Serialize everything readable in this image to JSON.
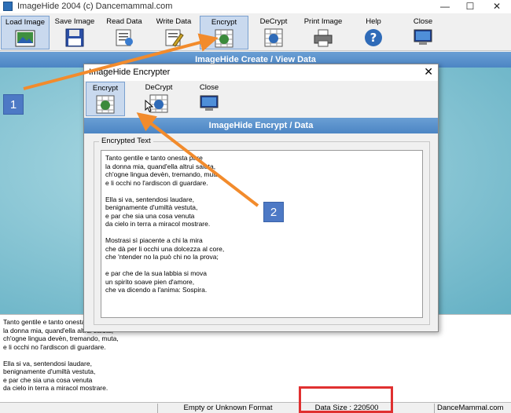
{
  "window": {
    "title": "ImageHide 2004 (c) Dancemammal.com",
    "min": "—",
    "max": "☐",
    "close": "✕"
  },
  "toolbar": {
    "buttons": [
      {
        "label": "Load Image",
        "icon": "load-image-icon"
      },
      {
        "label": "Save Image",
        "icon": "floppy-disk-icon"
      },
      {
        "label": "Read Data",
        "icon": "read-data-icon"
      },
      {
        "label": "Write Data",
        "icon": "write-data-icon"
      },
      {
        "label": "Encrypt",
        "icon": "encrypt-icon"
      },
      {
        "label": "DeCrypt",
        "icon": "decrypt-icon"
      },
      {
        "label": "Print Image",
        "icon": "printer-icon"
      },
      {
        "label": "Help",
        "icon": "help-icon"
      },
      {
        "label": "Close",
        "icon": "close-monitor-icon"
      }
    ]
  },
  "main_header": "ImageHide Create / View Data",
  "bottom_text": "Tanto gentile e tanto onesta\nla donna mia, quand'ella altrui saluta,\nch'ogne lingua devèn, tremando, muta,\ne li occhi no l'ardiscon di guardare.\n\nElla si va, sentendosi laudare,\nbenignamente d'umiltà vestuta,\ne par che sia una cosa venuta\nda cielo in terra a miracol mostrare.",
  "status": {
    "format": "Empty or Unknown Format",
    "size": "Data Size : 220500",
    "site": "DanceMammal.com"
  },
  "dialog": {
    "title": "ImageHide Encrypter",
    "close": "✕",
    "buttons": [
      {
        "label": "Encrypt",
        "icon": "encrypt-icon"
      },
      {
        "label": "DeCrypt",
        "icon": "decrypt-icon"
      },
      {
        "label": "Close",
        "icon": "close-monitor-icon"
      }
    ],
    "header": "ImageHide Encrypt / Data",
    "group_label": "Encrypted Text",
    "text": "Tanto gentile e tanto onesta pare\nla donna mia, quand'ella altrui saluta,\nch'ogne lingua devèn, tremando, muta,\ne li occhi no l'ardiscon di guardare.\n\nElla si va, sentendosi laudare,\nbenignamente d'umiltà vestuta,\ne par che sia una cosa venuta\nda cielo in terra a miracol mostrare.\n\nMostrasi sì piacente a chi la mira\nche dà per li occhi una dolcezza al core,\nche 'ntender no la può chi no la prova;\n\ne par che de la sua labbia si mova\nun spirito soave pien d'amore,\nche va dicendo a l'anima: Sospira."
  },
  "annotations": {
    "badge1": "1",
    "badge2": "2",
    "arrow_color": "#f28b2c",
    "highlight_color": "#e03030"
  }
}
